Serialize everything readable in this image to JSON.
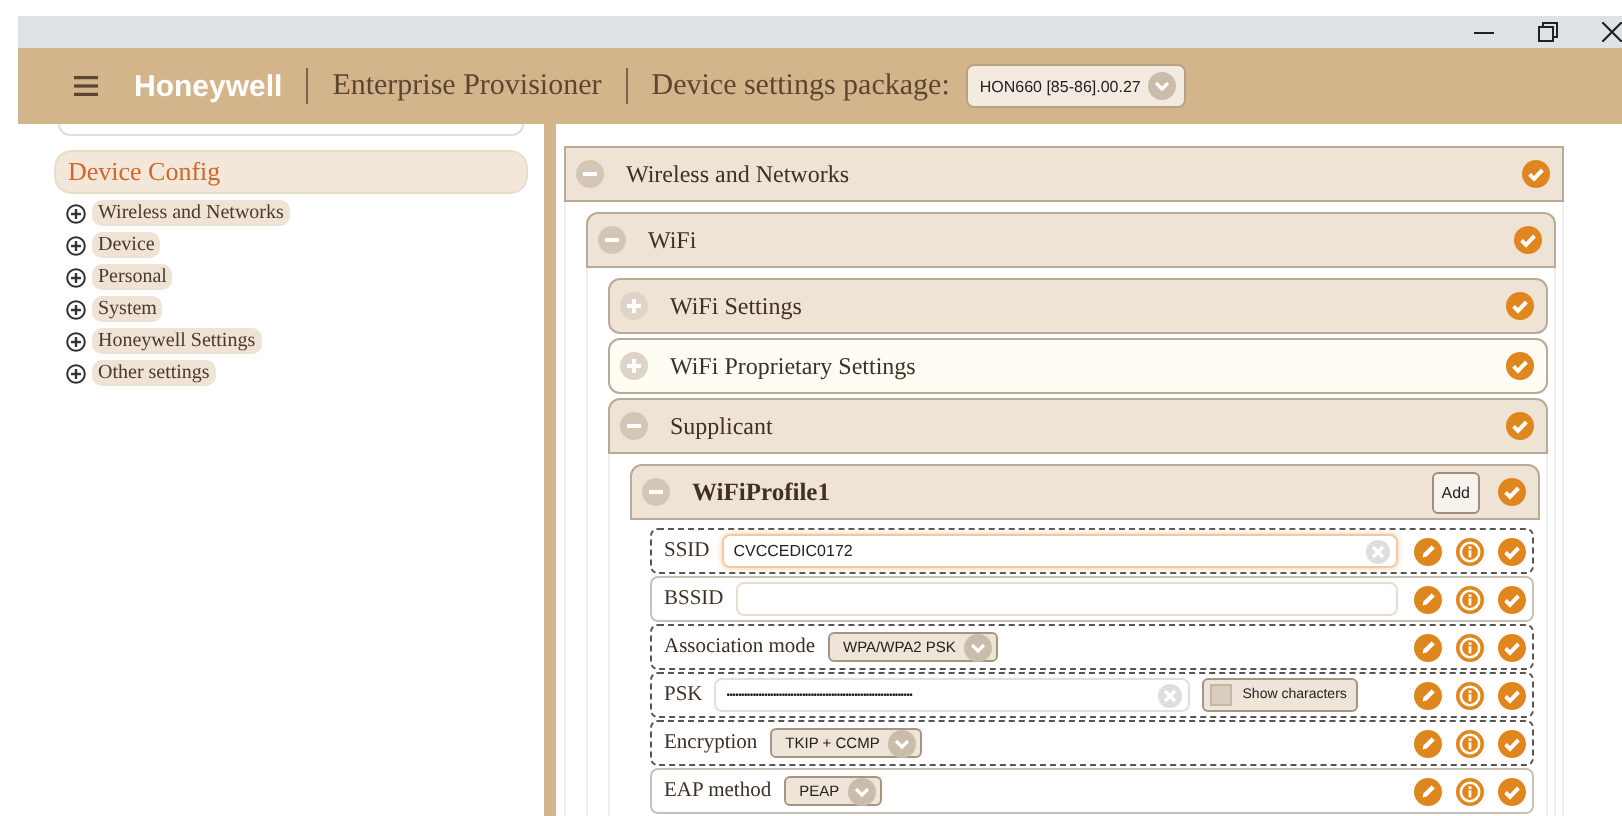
{
  "header": {
    "brand": "Honeywell",
    "app": "Enterprise Provisioner",
    "package_label": "Device settings package:",
    "package_value": "HON660 [85-86].00.27"
  },
  "sidebar": {
    "root": {
      "label": "Device Config",
      "selected": true
    },
    "items": [
      {
        "label": "Wireless and Networks",
        "expanded": false
      },
      {
        "label": "Device",
        "expanded": false
      },
      {
        "label": "Personal",
        "expanded": false
      },
      {
        "label": "System",
        "expanded": false
      },
      {
        "label": "Honeywell Settings",
        "expanded": false
      },
      {
        "label": "Other settings",
        "expanded": false
      }
    ]
  },
  "sections": [
    {
      "title": "Wireless and Networks",
      "expanded": true,
      "highlighted": false,
      "children": [
        {
          "title": "WiFi",
          "expanded": true,
          "highlighted": false,
          "children": [
            {
              "title": "WiFi Settings",
              "expanded": false,
              "highlighted": false
            },
            {
              "title": "WiFi Proprietary Settings",
              "expanded": false,
              "highlighted": true
            },
            {
              "title": "Supplicant",
              "expanded": true,
              "highlighted": false,
              "children": [
                {
                  "title": "WiFiProfile1",
                  "expanded": true,
                  "highlighted": false,
                  "add_button": "Add",
                  "fields": [
                    {
                      "kind": "text",
                      "label": "SSID",
                      "value": "CVCCEDIC0172",
                      "changed": true,
                      "focused": true
                    },
                    {
                      "kind": "text",
                      "label": "BSSID",
                      "changed": false,
                      "focused": false
                    },
                    {
                      "kind": "select",
                      "label": "Association mode",
                      "value": "WPA/WPA2 PSK",
                      "changed": true
                    },
                    {
                      "kind": "password",
                      "label": "PSK",
                      "value": "••••••••••••••••••••••••••••••••••••••••••••••••••••••••••••••••",
                      "toggle": "Show characters",
                      "show": false,
                      "changed": true
                    },
                    {
                      "kind": "select",
                      "label": "Encryption",
                      "value": "TKIP + CCMP",
                      "changed": true
                    },
                    {
                      "kind": "select",
                      "label": "EAP method",
                      "value": "PEAP",
                      "changed": false
                    }
                  ]
                }
              ]
            }
          ]
        }
      ]
    }
  ]
}
